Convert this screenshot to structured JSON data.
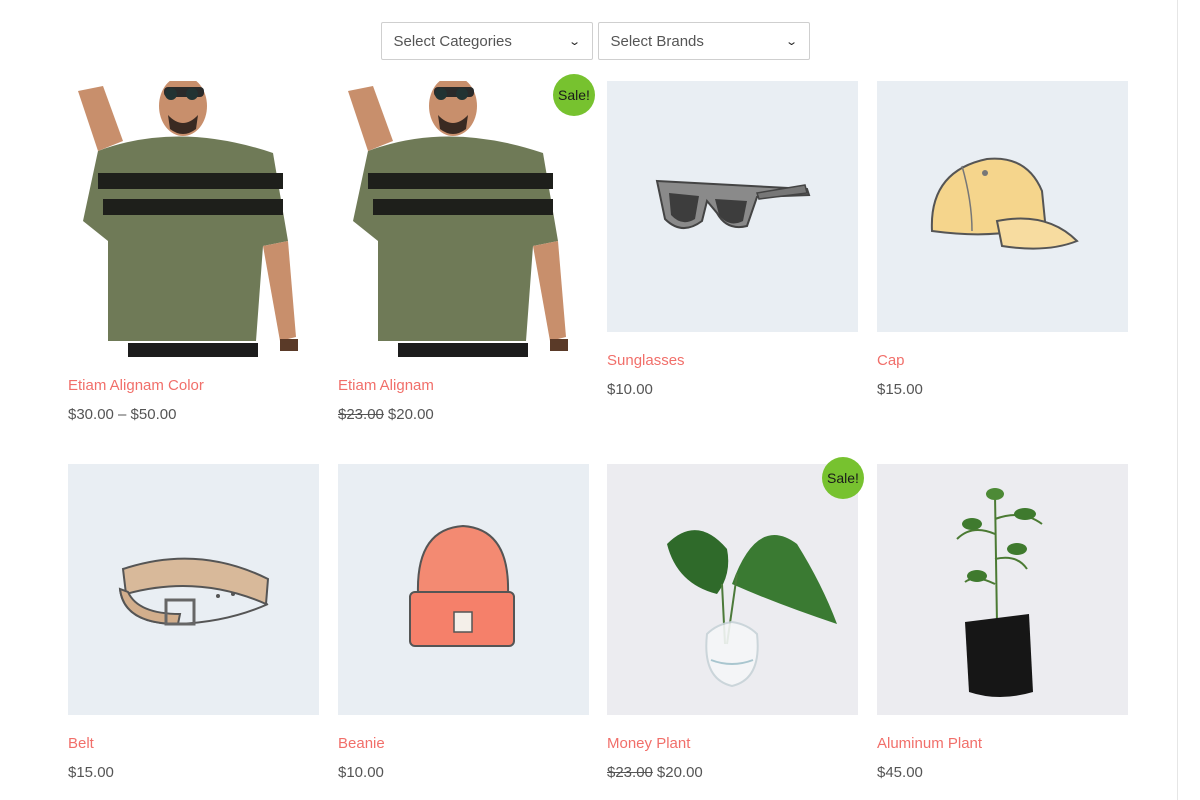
{
  "filters": {
    "categories": "Select Categories",
    "brands": "Select Brands"
  },
  "products": [
    {
      "title": "Etiam Alignam Color",
      "price": "$30.00 – $50.00",
      "old_price": "",
      "sale": "",
      "icon": "tshirt-model-image"
    },
    {
      "title": "Etiam Alignam",
      "price": "$20.00",
      "old_price": "$23.00",
      "sale": "Sale!",
      "icon": "tshirt-model-image"
    },
    {
      "title": "Sunglasses",
      "price": "$10.00",
      "old_price": "",
      "sale": "",
      "icon": "sunglasses-image"
    },
    {
      "title": "Cap",
      "price": "$15.00",
      "old_price": "",
      "sale": "",
      "icon": "cap-image"
    },
    {
      "title": "Belt",
      "price": "$15.00",
      "old_price": "",
      "sale": "",
      "icon": "belt-image"
    },
    {
      "title": "Beanie",
      "price": "$10.00",
      "old_price": "",
      "sale": "",
      "icon": "beanie-image"
    },
    {
      "title": "Money Plant",
      "price": "$20.00",
      "old_price": "$23.00",
      "sale": "Sale!",
      "icon": "money-plant-image"
    },
    {
      "title": "Aluminum Plant",
      "price": "$45.00",
      "old_price": "",
      "sale": "",
      "icon": "aluminum-plant-image"
    }
  ],
  "colors": {
    "title": "#f16f6a",
    "price": "#555555",
    "sale_badge": "#77c22f",
    "image_bg": "#e9eef3"
  }
}
